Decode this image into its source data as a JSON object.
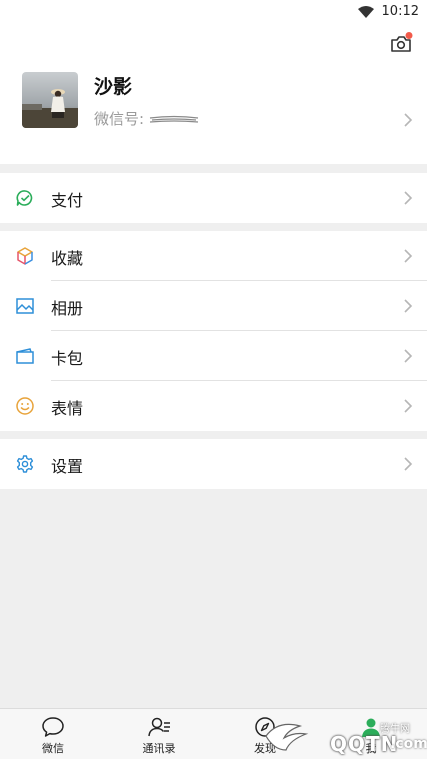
{
  "status_bar": {
    "time": "10:12",
    "icons": [
      "wifi-icon",
      "battery-icon"
    ]
  },
  "profile": {
    "nickname": "沙影",
    "wechat_id_label": "微信号:",
    "camera_icon": "camera-icon",
    "notification_dot_color": "#f25a4a"
  },
  "menu": {
    "pay": {
      "label": "支付",
      "icon": "wallet-check-icon",
      "color": "#2bad5a"
    },
    "favorites": {
      "label": "收藏",
      "icon": "cube-icon"
    },
    "album": {
      "label": "相册",
      "icon": "image-icon",
      "color": "#2e8fd8"
    },
    "cards": {
      "label": "卡包",
      "icon": "card-icon",
      "color": "#2e8fd8"
    },
    "stickers": {
      "label": "表情",
      "icon": "smiley-icon",
      "color": "#e8a33a"
    },
    "settings": {
      "label": "设置",
      "icon": "gear-icon",
      "color": "#2e8fd8"
    }
  },
  "tabbar": {
    "tabs": [
      {
        "label": "微信",
        "icon": "chat-bubble-icon"
      },
      {
        "label": "通讯录",
        "icon": "contacts-icon"
      },
      {
        "label": "发现",
        "icon": "compass-icon"
      },
      {
        "label": "我",
        "icon": "person-icon"
      }
    ]
  },
  "watermark": {
    "brand": "QQTN",
    "suffix": ".com",
    "tag": "腾牛网"
  }
}
